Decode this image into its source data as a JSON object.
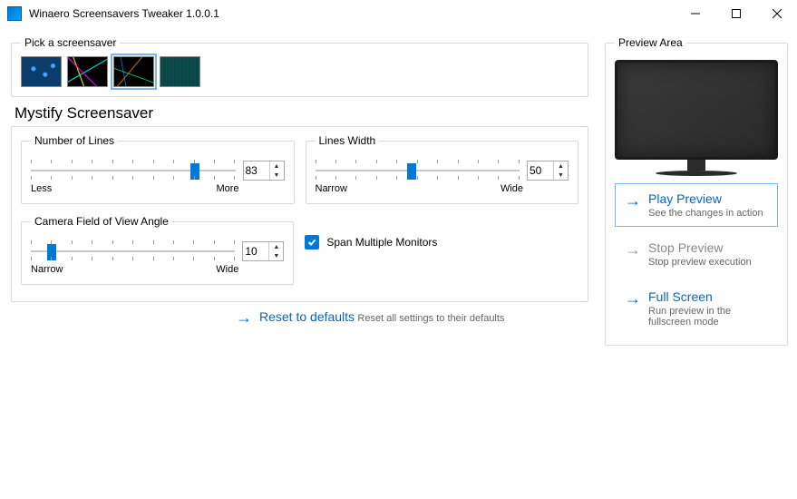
{
  "window": {
    "title": "Winaero Screensavers Tweaker 1.0.0.1"
  },
  "picker": {
    "legend": "Pick a screensaver"
  },
  "mainHeading": "Mystify Screensaver",
  "settings": {
    "lines": {
      "legend": "Number of Lines",
      "value": "83",
      "minLabel": "Less",
      "maxLabel": "More"
    },
    "width": {
      "legend": "Lines Width",
      "value": "50",
      "minLabel": "Narrow",
      "maxLabel": "Wide"
    },
    "fov": {
      "legend": "Camera Field of View Angle",
      "value": "10",
      "minLabel": "Narrow",
      "maxLabel": "Wide"
    },
    "spanMonitors": "Span Multiple Monitors"
  },
  "reset": {
    "title": "Reset to defaults",
    "sub": "Reset all settings to their defaults"
  },
  "preview": {
    "legend": "Preview Area",
    "play": {
      "title": "Play Preview",
      "sub": "See the changes in action"
    },
    "stop": {
      "title": "Stop Preview",
      "sub": "Stop preview execution"
    },
    "full": {
      "title": "Full Screen",
      "sub": "Run preview in the fullscreen mode"
    }
  }
}
